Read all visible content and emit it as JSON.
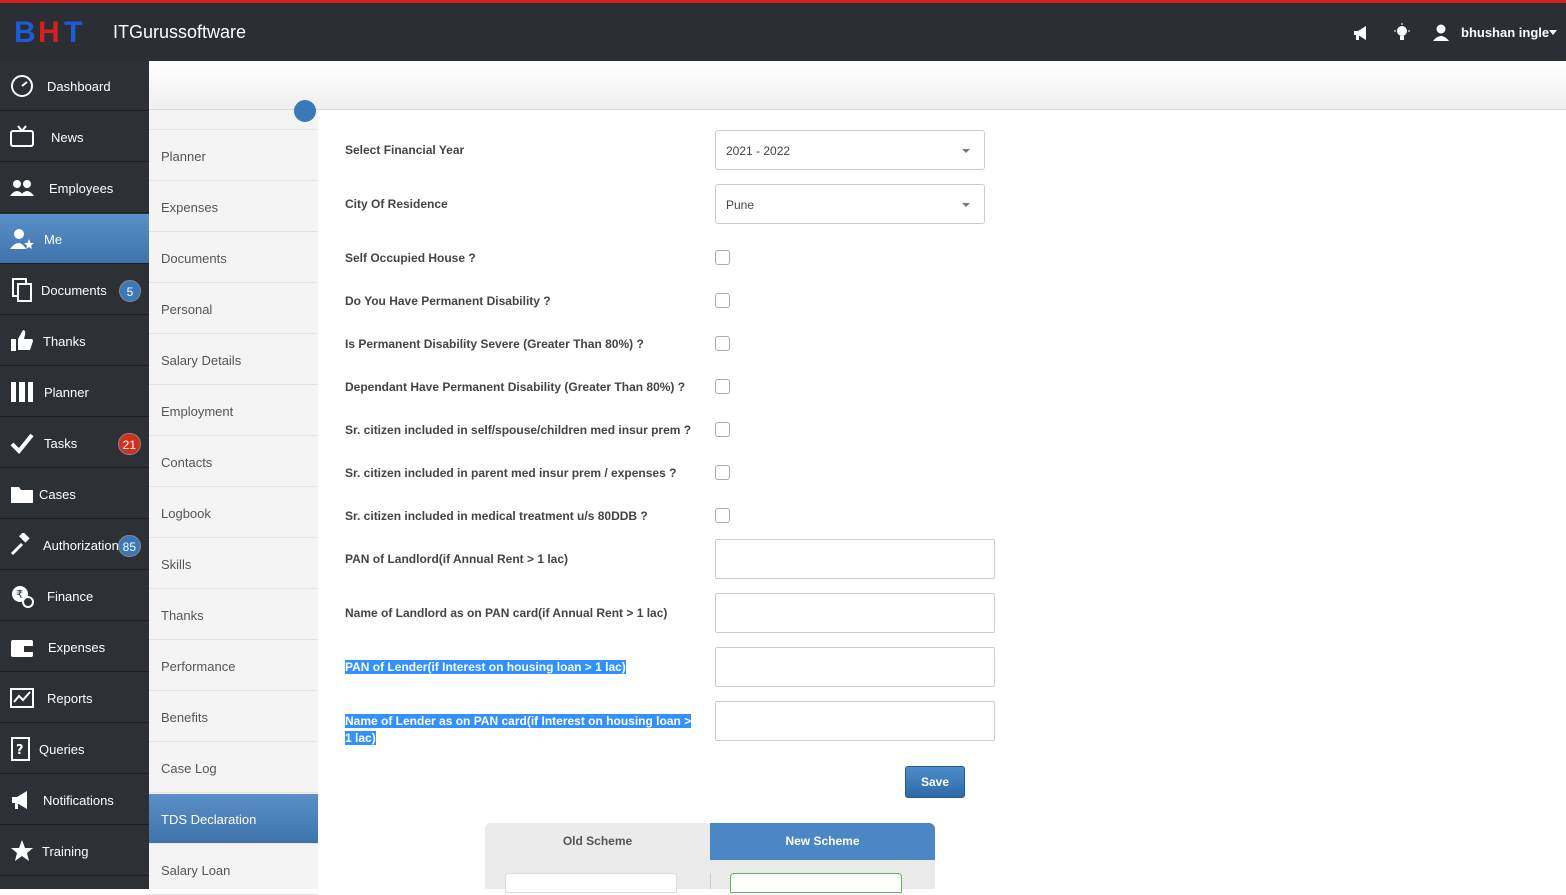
{
  "header": {
    "brand_logo_text": "BHT",
    "brand_name": "ITGurussoftware",
    "user_name": "bhushan ingle",
    "icons": [
      "megaphone-icon",
      "lightbulb-icon",
      "user-icon",
      "caret-down-icon"
    ],
    "colors": {
      "topbar": "#2b2e33",
      "accent_line": "#d81e1e"
    }
  },
  "sidebar": {
    "items": [
      {
        "label": "Dashboard",
        "icon": "dashboard-icon"
      },
      {
        "label": "News",
        "icon": "tv-icon"
      },
      {
        "label": "Employees",
        "icon": "users-icon"
      },
      {
        "label": "Me",
        "icon": "user-star-icon",
        "active": true
      },
      {
        "label": "Documents",
        "icon": "documents-icon",
        "badge": "5"
      },
      {
        "label": "Thanks",
        "icon": "thumbs-up-icon"
      },
      {
        "label": "Planner",
        "icon": "planner-icon"
      },
      {
        "label": "Tasks",
        "icon": "check-icon",
        "badge": "21"
      },
      {
        "label": "Cases",
        "icon": "folder-icon"
      },
      {
        "label": "Authorizations",
        "icon": "gavel-icon",
        "badge": "85"
      },
      {
        "label": "Finance",
        "icon": "finance-icon"
      },
      {
        "label": "Expenses",
        "icon": "wallet-icon"
      },
      {
        "label": "Reports",
        "icon": "chart-icon"
      },
      {
        "label": "Queries",
        "icon": "question-icon"
      },
      {
        "label": "Notifications",
        "icon": "megaphone-icon"
      },
      {
        "label": "Training",
        "icon": "star-icon"
      }
    ],
    "colors": {
      "bg": "#2d3035",
      "active": "#4a80ba",
      "badge_blue": "#3a78b8",
      "badge_red": "#d0301e"
    }
  },
  "submenu": {
    "items": [
      {
        "label": "Planner"
      },
      {
        "label": "Expenses"
      },
      {
        "label": "Documents"
      },
      {
        "label": "Personal"
      },
      {
        "label": "Salary Details"
      },
      {
        "label": "Employment"
      },
      {
        "label": "Contacts"
      },
      {
        "label": "Logbook"
      },
      {
        "label": "Skills"
      },
      {
        "label": "Thanks"
      },
      {
        "label": "Performance"
      },
      {
        "label": "Benefits"
      },
      {
        "label": "Case Log"
      },
      {
        "label": "TDS Declaration",
        "active": true
      },
      {
        "label": "Salary Loan"
      }
    ]
  },
  "form": {
    "financial_year": {
      "label": "Select Financial Year",
      "value": "2021 - 2022"
    },
    "city": {
      "label": "City Of Residence",
      "value": "Pune"
    },
    "checkboxes": [
      {
        "label": "Self Occupied House ?",
        "checked": false
      },
      {
        "label": "Do You Have Permanent Disability ?",
        "checked": false
      },
      {
        "label": "Is Permanent Disability Severe (Greater Than 80%) ?",
        "checked": false
      },
      {
        "label": "Dependant Have Permanent Disability (Greater Than 80%) ?",
        "checked": false
      },
      {
        "label": "Sr. citizen included in self/spouse/children med insur prem ?",
        "checked": false
      },
      {
        "label": "Sr. citizen included in parent med insur prem / expenses ?",
        "checked": false
      },
      {
        "label": "Sr. citizen included in medical treatment u/s 80DDB ?",
        "checked": false
      }
    ],
    "text_fields": [
      {
        "label": "PAN of Landlord(if Annual Rent > 1 lac)",
        "value": ""
      },
      {
        "label": "Name of Landlord as on PAN card(if Annual Rent > 1 lac)",
        "value": ""
      },
      {
        "label": "PAN of Lender(if Interest on housing loan > 1 lac)",
        "value": ""
      },
      {
        "label": "Name of Lender as on PAN card(if Interest on housing loan > 1 lac)",
        "value": ""
      }
    ],
    "save_label": "Save"
  },
  "scheme": {
    "tabs": [
      {
        "label": "Old Scheme",
        "active": false
      },
      {
        "label": "New Scheme",
        "active": true
      }
    ]
  }
}
